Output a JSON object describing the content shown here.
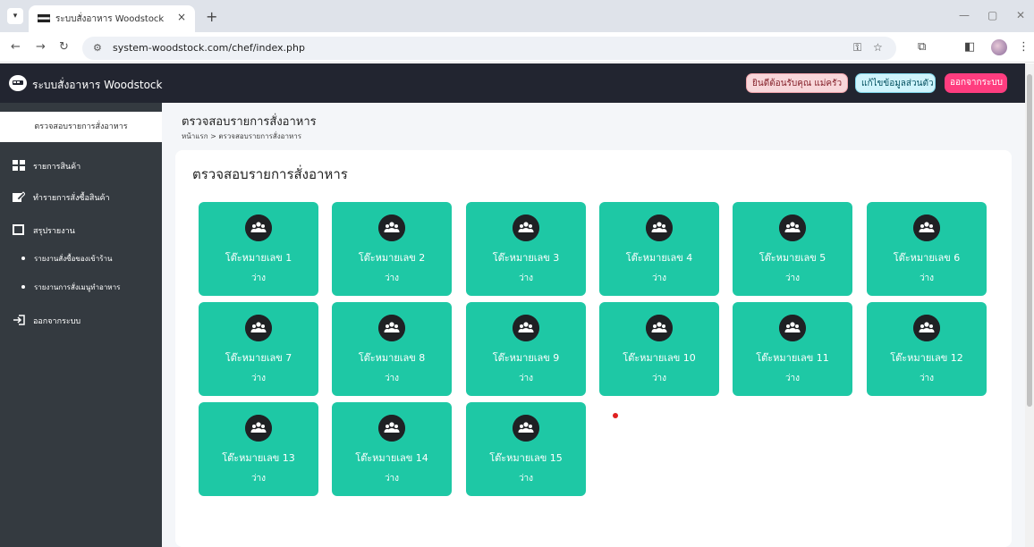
{
  "browser": {
    "tab_title": "ระบบสั่งอาหาร Woodstock",
    "tab_close": "×",
    "new_tab": "+",
    "url": "system-woodstock.com/chef/index.php",
    "icons": [
      "chevron-down-icon",
      "flag-favicon-icon",
      "close-icon",
      "plus-icon",
      "back-icon",
      "forward-icon",
      "reload-icon",
      "site-info-icon",
      "password-key-icon",
      "star-icon",
      "extensions-icon",
      "side-panel-icon",
      "profile-avatar",
      "menu-icon",
      "minimize-icon",
      "restore-icon",
      "close-window-icon"
    ]
  },
  "navbar": {
    "brand": "ระบบสั่งอาหาร Woodstock",
    "welcome": "ยินดีต้อนรับคุณ แม่ครัว",
    "edit_profile": "แก้ไขข้อมูลส่วนตัว",
    "logout": "ออกจากระบบ",
    "colors": {
      "bg": "#222530",
      "welcome_bg": "#f8d7da",
      "profile_bg": "#cff4fc",
      "logout_bg": "#ff3d7f"
    }
  },
  "sidebar": {
    "active": "ตรวจสอบรายการสั่งอาหาร",
    "items": [
      {
        "label": "รายการสินค้า",
        "icon": "grid-icon"
      },
      {
        "label": "ทำรายการสั่งซื้อสินค้า",
        "icon": "edit-icon"
      },
      {
        "label": "สรุปรายงาน",
        "icon": "report-icon"
      }
    ],
    "sub_items": [
      {
        "label": "รายงานสั่งซื้อของเข้าร้าน"
      },
      {
        "label": "รายงานการสั่งเมนูทำอาหาร"
      }
    ],
    "logout": {
      "label": "ออกจากระบบ",
      "icon": "logout-icon"
    }
  },
  "content": {
    "page_title": "ตรวจสอบรายการสั่งอาหาร",
    "breadcrumb": "หน้าแรก > ตรวจสอบรายการสั่งอาหาร",
    "card_title": "ตรวจสอบรายการสั่งอาหาร",
    "tile_color": "#1ec8a5",
    "tables": [
      {
        "name": "โต๊ะหมายเลข 1",
        "status": "ว่าง"
      },
      {
        "name": "โต๊ะหมายเลข 2",
        "status": "ว่าง"
      },
      {
        "name": "โต๊ะหมายเลข 3",
        "status": "ว่าง"
      },
      {
        "name": "โต๊ะหมายเลข 4",
        "status": "ว่าง"
      },
      {
        "name": "โต๊ะหมายเลข 5",
        "status": "ว่าง"
      },
      {
        "name": "โต๊ะหมายเลข 6",
        "status": "ว่าง"
      },
      {
        "name": "โต๊ะหมายเลข 7",
        "status": "ว่าง"
      },
      {
        "name": "โต๊ะหมายเลข 8",
        "status": "ว่าง"
      },
      {
        "name": "โต๊ะหมายเลข 9",
        "status": "ว่าง"
      },
      {
        "name": "โต๊ะหมายเลข 10",
        "status": "ว่าง"
      },
      {
        "name": "โต๊ะหมายเลข 11",
        "status": "ว่าง"
      },
      {
        "name": "โต๊ะหมายเลข 12",
        "status": "ว่าง"
      },
      {
        "name": "โต๊ะหมายเลข 13",
        "status": "ว่าง"
      },
      {
        "name": "โต๊ะหมายเลข 14",
        "status": "ว่าง"
      },
      {
        "name": "โต๊ะหมายเลข 15",
        "status": "ว่าง"
      }
    ]
  }
}
